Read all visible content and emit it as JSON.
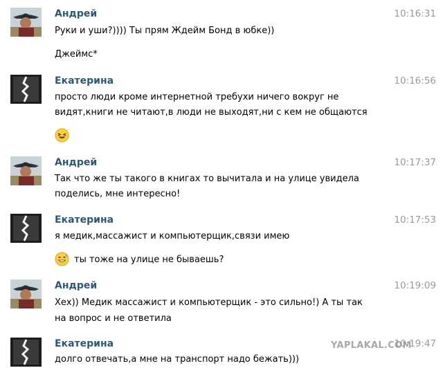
{
  "messages": [
    {
      "author": "Андрей",
      "time": "10:16:31",
      "lines": [
        "Руки и уши?)))) Ты прям Ждейм Бонд в юбке))",
        "Джеймс*"
      ]
    },
    {
      "author": "Екатерина",
      "time": "10:16:56",
      "lines": [
        "просто люди кроме интернетной требухи ничего вокруг не",
        "видят,книги не читают,в люди не выходят,ни с кем не общаются"
      ],
      "emoji": "laughing-smiley-icon"
    },
    {
      "author": "Андрей",
      "time": "10:17:37",
      "lines": [
        "Так что же ты такого в книгах то вычитала и на улице увидела",
        "поделись, мне интересно!"
      ]
    },
    {
      "author": "Екатерина",
      "time": "10:17:53",
      "lines": [
        "я медик,массажист и компьютерщик,связи имею",
        "ты тоже на улице не бываешь?"
      ],
      "emoji": "sweat-smile-smiley-icon"
    },
    {
      "author": "Андрей",
      "time": "10:19:09",
      "lines": [
        "Хех)) Медик массажист и компьютерщик - это сильно!) А ты так",
        "на вопрос и не ответила"
      ]
    },
    {
      "author": "Екатерина",
      "time": "10:19:47",
      "lines": [
        "долго отвечать,а мне на транспорт надо бежать)))"
      ]
    }
  ],
  "watermark": "YAPLAKAL.COM",
  "colors": {
    "author": "#2b587a",
    "time": "#999999",
    "text": "#000000"
  }
}
